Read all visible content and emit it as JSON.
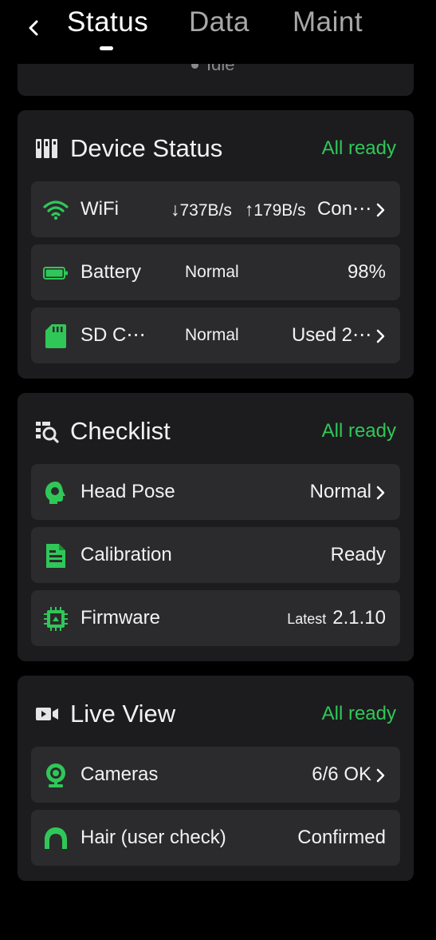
{
  "header": {
    "tabs": [
      {
        "label": "Status"
      },
      {
        "label": "Data"
      },
      {
        "label": "Maint"
      }
    ]
  },
  "partial_top": {
    "text": "Idle"
  },
  "device_status": {
    "title": "Device Status",
    "status": "All ready",
    "wifi": {
      "label": "WiFi",
      "down": "737B/s",
      "up": "179B/s",
      "value": "Con⋯"
    },
    "battery": {
      "label": "Battery",
      "state": "Normal",
      "value": "98%"
    },
    "sd": {
      "label": "SD C⋯",
      "state": "Normal",
      "value": "Used 2⋯"
    }
  },
  "checklist": {
    "title": "Checklist",
    "status": "All ready",
    "head_pose": {
      "label": "Head Pose",
      "value": "Normal"
    },
    "calibration": {
      "label": "Calibration",
      "value": "Ready"
    },
    "firmware": {
      "label": "Firmware",
      "prefix": "Latest",
      "value": "2.1.10"
    }
  },
  "live_view": {
    "title": "Live View",
    "status": "All ready",
    "cameras": {
      "label": "Cameras",
      "value": "6/6 OK"
    },
    "hair": {
      "label": "Hair (user check)",
      "value": "Confirmed"
    }
  },
  "colors": {
    "accent": "#30c759",
    "card": "#1c1c1e",
    "row": "#2b2b2d",
    "background": "#000000"
  }
}
